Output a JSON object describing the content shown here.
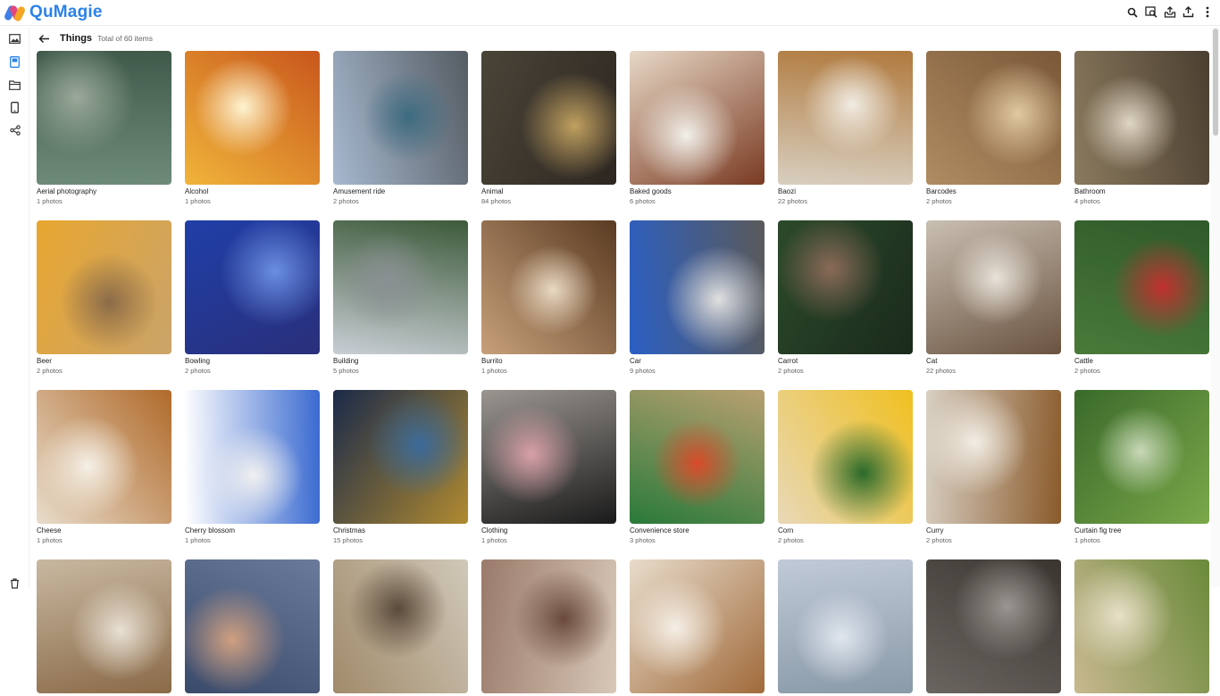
{
  "app": {
    "name": "QuMagie"
  },
  "header": {
    "title": "Things",
    "subtitle": "Total of 60 items"
  },
  "toolbar_icons": [
    "search-icon",
    "image-search-icon",
    "upload-tray-icon",
    "share-upload-icon",
    "more-vert-icon"
  ],
  "sidebar_icons": [
    "photos-icon",
    "albums-icon",
    "folders-icon",
    "mobile-icon",
    "share-icon",
    "trash-icon"
  ],
  "items": [
    {
      "label": "Aerial photography",
      "count": "1 photos",
      "colors": [
        "#6e8b7a",
        "#3f5a4a",
        "#9aa89a"
      ]
    },
    {
      "label": "Alcohol",
      "count": "1 photos",
      "colors": [
        "#f0b43a",
        "#c8571c",
        "#fff3d0"
      ]
    },
    {
      "label": "Amusement ride",
      "count": "2 photos",
      "colors": [
        "#a7b9cf",
        "#555c63",
        "#3d6b80"
      ]
    },
    {
      "label": "Animal",
      "count": "84 photos",
      "colors": [
        "#4a4438",
        "#2c2620",
        "#c1a060"
      ]
    },
    {
      "label": "Baked goods",
      "count": "6 photos",
      "colors": [
        "#e7d8c6",
        "#7a3a22",
        "#f2f0ea"
      ]
    },
    {
      "label": "Baozi",
      "count": "22 photos",
      "colors": [
        "#d8cfc0",
        "#b07a3e",
        "#f1ece3"
      ]
    },
    {
      "label": "Barcodes",
      "count": "2 photos",
      "colors": [
        "#b08c62",
        "#7a5838",
        "#e1c9a2"
      ]
    },
    {
      "label": "Bathroom",
      "count": "4 photos",
      "colors": [
        "#8a7a5e",
        "#4a3f30",
        "#e0d6c4"
      ]
    },
    {
      "label": "Beer",
      "count": "2 photos",
      "colors": [
        "#e8a630",
        "#caa46a",
        "#8b6b48"
      ]
    },
    {
      "label": "Bowling",
      "count": "2 photos",
      "colors": [
        "#1f3fa8",
        "#2a2f7a",
        "#6a8ee0"
      ]
    },
    {
      "label": "Building",
      "count": "5 photos",
      "colors": [
        "#c9ced4",
        "#3c5a3a",
        "#8a8f93"
      ]
    },
    {
      "label": "Burrito",
      "count": "1 photos",
      "colors": [
        "#c7a07a",
        "#5a3b22",
        "#e9d9c3"
      ]
    },
    {
      "label": "Car",
      "count": "9 photos",
      "colors": [
        "#2b5fc4",
        "#5a5a5a",
        "#e0e0e0"
      ]
    },
    {
      "label": "Carrot",
      "count": "2 photos",
      "colors": [
        "#2c4a2a",
        "#1a2a1c",
        "#8a6a58"
      ]
    },
    {
      "label": "Cat",
      "count": "22 photos",
      "colors": [
        "#c9bfb2",
        "#6a5340",
        "#e8e2d8"
      ]
    },
    {
      "label": "Cattle",
      "count": "2 photos",
      "colors": [
        "#4a7a3a",
        "#2f5a2a",
        "#c23030"
      ]
    },
    {
      "label": "Cheese",
      "count": "1 photos",
      "colors": [
        "#e8dccb",
        "#b06a2a",
        "#f5f0e6"
      ]
    },
    {
      "label": "Cherry blossom",
      "count": "1 photos",
      "colors": [
        "#ffffff",
        "#3a6ad0",
        "#f0f0f0"
      ]
    },
    {
      "label": "Christmas",
      "count": "15 photos",
      "colors": [
        "#1a2a4a",
        "#b08a30",
        "#3a6a9a"
      ]
    },
    {
      "label": "Clothing",
      "count": "1 photos",
      "colors": [
        "#9a9590",
        "#1a1a1a",
        "#d8a0a8"
      ]
    },
    {
      "label": "Convenience store",
      "count": "3 photos",
      "colors": [
        "#2a7a3a",
        "#b8a070",
        "#d84a2a"
      ]
    },
    {
      "label": "Corn",
      "count": "2 photos",
      "colors": [
        "#e8d8b8",
        "#f0c020",
        "#2a6a2a"
      ]
    },
    {
      "label": "Curry",
      "count": "2 photos",
      "colors": [
        "#d8d0c4",
        "#8a5a2a",
        "#f2ede4"
      ]
    },
    {
      "label": "Curtain fig tree",
      "count": "1 photos",
      "colors": [
        "#3a6a2a",
        "#7aa84a",
        "#c8d8b8"
      ]
    },
    {
      "label": "",
      "count": "",
      "colors": [
        "#c8b8a0",
        "#8a6a48",
        "#e8e0d4"
      ]
    },
    {
      "label": "",
      "count": "",
      "colors": [
        "#3a4a6a",
        "#6a7a9a",
        "#d0a080"
      ]
    },
    {
      "label": "",
      "count": "",
      "colors": [
        "#a08a6a",
        "#d0c8b8",
        "#5a4a3a"
      ]
    },
    {
      "label": "",
      "count": "",
      "colors": [
        "#9a7a6a",
        "#d8c8b8",
        "#6a4a3a"
      ]
    },
    {
      "label": "",
      "count": "",
      "colors": [
        "#e8dccb",
        "#a06a3a",
        "#f5efe6"
      ]
    },
    {
      "label": "",
      "count": "",
      "colors": [
        "#c0cad8",
        "#8a9aa8",
        "#e0e6ee"
      ]
    },
    {
      "label": "",
      "count": "",
      "colors": [
        "#6a6560",
        "#3a3530",
        "#9a9590"
      ]
    },
    {
      "label": "",
      "count": "",
      "colors": [
        "#c8b890",
        "#6a8a3a",
        "#e8e0c8"
      ]
    }
  ]
}
